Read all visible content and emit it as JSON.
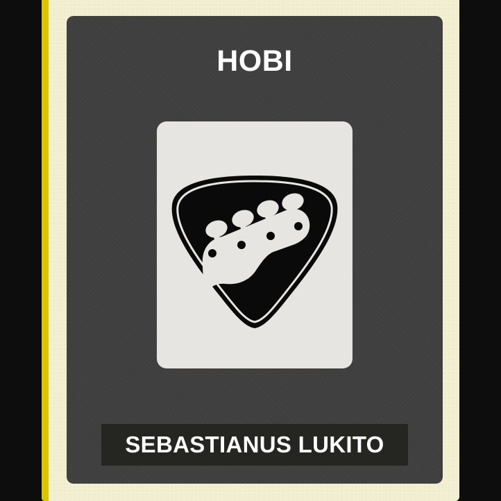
{
  "card": {
    "title": "HOBI",
    "icon": "guitar-pick-bass-headstock-icon",
    "name": "SEBASTIANUS LUKITO"
  },
  "colors": {
    "background": "#0d0d0d",
    "card": "#f3efd3",
    "accent": "#d8c400",
    "panel": "#3f3f3f",
    "icon_tile": "#e7e5e1",
    "text": "#ffffff"
  }
}
